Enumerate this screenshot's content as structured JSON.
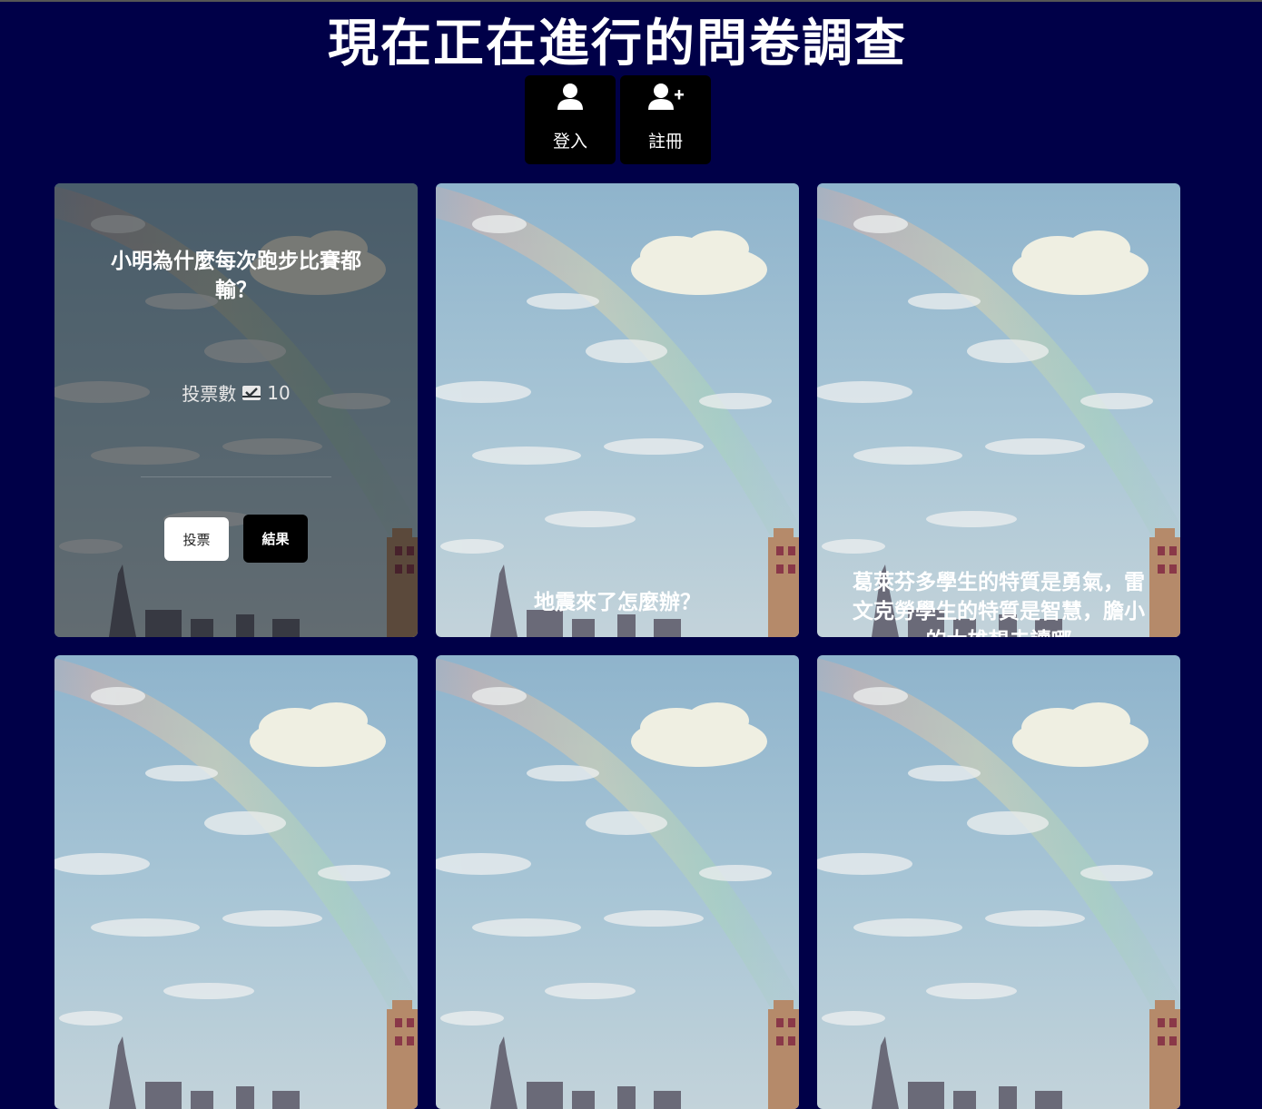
{
  "page": {
    "title": "現在正在進行的問卷調查"
  },
  "auth": {
    "login_label": "登入",
    "register_label": "註冊",
    "login_icon": "user-icon",
    "register_icon": "user-plus-icon"
  },
  "colors": {
    "background": "#000048",
    "button_dark": "#000000",
    "button_light": "#ffffff"
  },
  "surveys": [
    {
      "title": "小明為什麼每次跑步比賽都輸？",
      "votes_label": "投票數",
      "votes_icon": "inbox-check-icon",
      "vote_count": "10",
      "vote_button": "投票",
      "result_button": "結果"
    },
    {
      "title": "地震來了怎麼辦？"
    },
    {
      "title": "葛萊芬多學生的特質是勇氣，雷文克勞學生的特質是智慧，膽小的大雄想去讀哪"
    },
    {
      "title": ""
    },
    {
      "title": ""
    },
    {
      "title": ""
    }
  ]
}
